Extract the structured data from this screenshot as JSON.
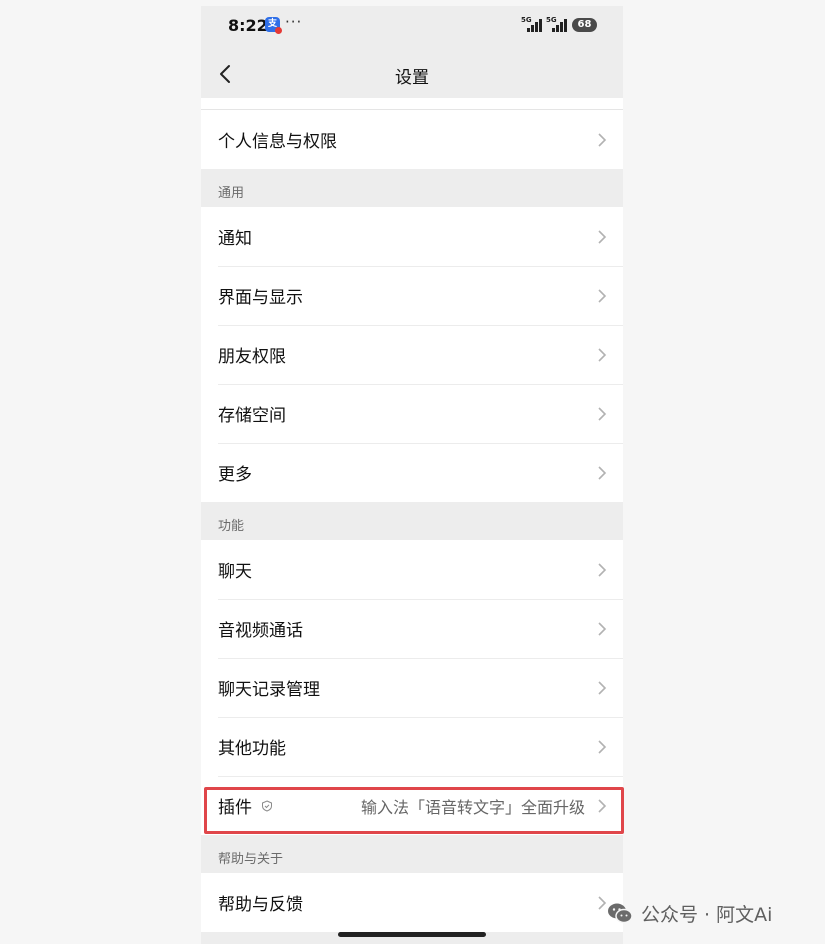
{
  "status_bar": {
    "time": "8:22",
    "app_badge": "支",
    "more": "···",
    "signal_1": "5G",
    "signal_2": "5G",
    "battery": "68"
  },
  "nav": {
    "title": "设置",
    "back_icon": "chevron-left-icon"
  },
  "sections": {
    "account": {
      "items": [
        {
          "label": "个人信息与权限"
        }
      ]
    },
    "general": {
      "header": "通用",
      "items": [
        {
          "label": "通知"
        },
        {
          "label": "界面与显示"
        },
        {
          "label": "朋友权限"
        },
        {
          "label": "存储空间"
        },
        {
          "label": "更多"
        }
      ]
    },
    "features": {
      "header": "功能",
      "items": [
        {
          "label": "聊天"
        },
        {
          "label": "音视频通话"
        },
        {
          "label": "聊天记录管理"
        },
        {
          "label": "其他功能"
        },
        {
          "label": "插件",
          "hint": "输入法「语音转文字」全面升级",
          "icon": "shield-icon"
        }
      ]
    },
    "help": {
      "header": "帮助与关于",
      "items": [
        {
          "label": "帮助与反馈"
        }
      ]
    }
  },
  "watermark": {
    "text": "公众号 · 阿文Ai",
    "icon": "wechat-icon"
  },
  "colors": {
    "highlight_border": "#e0464a",
    "background": "#ededed"
  }
}
